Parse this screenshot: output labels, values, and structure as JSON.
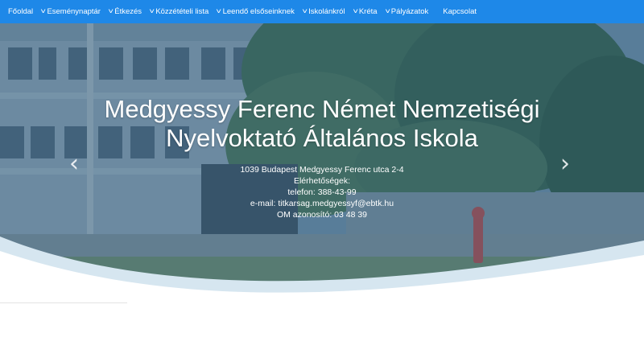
{
  "nav": {
    "items": [
      {
        "label": "Főoldal",
        "chevron": false
      },
      {
        "label": "Eseménynaptár",
        "chevron": true
      },
      {
        "label": "Étkezés",
        "chevron": true
      },
      {
        "label": "Közzétételi lista",
        "chevron": true
      },
      {
        "label": "Leendő elsőseinknek",
        "chevron": true
      },
      {
        "label": "Iskolánkról",
        "chevron": true
      },
      {
        "label": "Kréta",
        "chevron": true
      },
      {
        "label": "Pályázatok",
        "chevron": true
      },
      {
        "label": "Kapcsolat",
        "chevron": false
      }
    ],
    "chevron_glyph": "˅",
    "color": "#1e88e8"
  },
  "hero": {
    "title_line1": "Medgyessy Ferenc Német Nemzetiségi",
    "title_line2": "Nyelvoktató Általános Iskola",
    "address": "1039 Budapest Medgyessy Ferenc utca 2-4",
    "contacts_label": "Elérhetőségek:",
    "phone": "telefon: 388-43-99",
    "email": "e-mail: titkarsag.medgyessyf@ebtk.hu",
    "om": "OM azonosító: 03 48 39",
    "prev_glyph": "‹",
    "next_glyph": "›",
    "overlay_color": "#2f5f82",
    "wave_color": "#d6e6f0"
  }
}
